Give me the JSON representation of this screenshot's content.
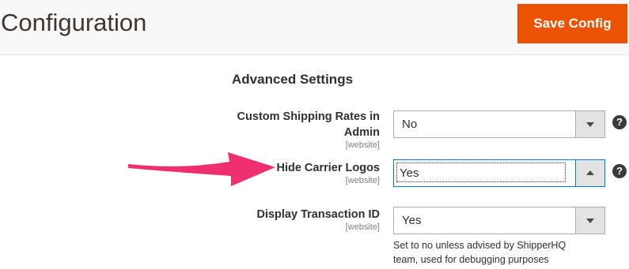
{
  "header": {
    "title": "Configuration",
    "save_label": "Save Config"
  },
  "section": {
    "title": "Advanced Settings"
  },
  "fields": [
    {
      "label": "Custom Shipping Rates in Admin",
      "scope": "[website]",
      "value": "No",
      "help_icon": "question-icon"
    },
    {
      "label": "Hide Carrier Logos",
      "scope": "[website]",
      "value": "Yes",
      "help_icon": "question-icon",
      "state": "open"
    },
    {
      "label": "Display Transaction ID",
      "scope": "[website]",
      "value": "Yes",
      "note": "Set to no unless advised by ShipperHQ team, used for debugging purposes"
    }
  ],
  "help_glyph": "?",
  "colors": {
    "accent": "#eb5202",
    "focus": "#007bdb",
    "annotation_arrow": "#f0306e"
  }
}
